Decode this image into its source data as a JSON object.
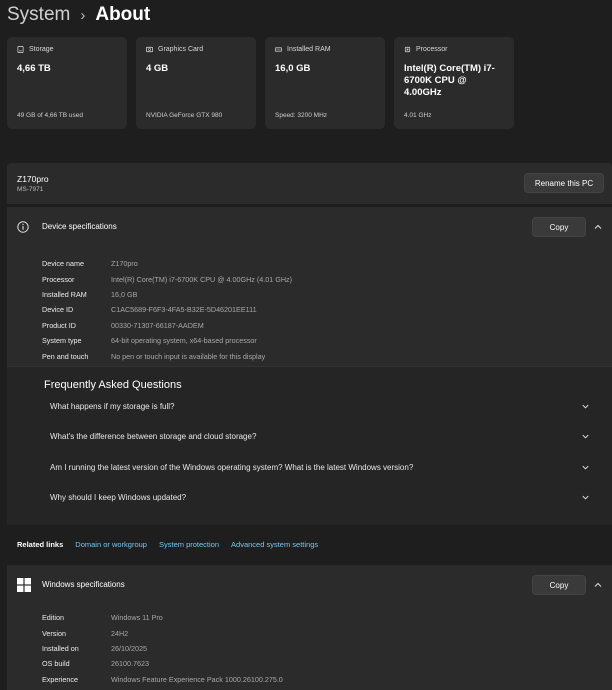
{
  "breadcrumb": {
    "parent": "System",
    "separator": "›",
    "current": "About"
  },
  "cards": [
    {
      "icon": "storage-icon",
      "label": "Storage",
      "value": "4,66 TB",
      "sub": "49 GB of 4,66 TB used"
    },
    {
      "icon": "graphics-card-icon",
      "label": "Graphics Card",
      "value": "4 GB",
      "sub": "NVIDIA GeForce GTX 980"
    },
    {
      "icon": "ram-icon",
      "label": "Installed RAM",
      "value": "16,0 GB",
      "sub": "Speed: 3200 MHz"
    },
    {
      "icon": "processor-icon",
      "label": "Processor",
      "value": "Intel(R) Core(TM) i7-6700K CPU @ 4.00GHz",
      "sub": "4.01 GHz"
    }
  ],
  "pc": {
    "name": "Z170pro",
    "model": "MS-7971",
    "rename_label": "Rename this PC"
  },
  "device_specs": {
    "title": "Device specifications",
    "copy_label": "Copy",
    "rows": [
      {
        "label": "Device name",
        "value": "Z170pro"
      },
      {
        "label": "Processor",
        "value": "Intel(R) Core(TM) i7-6700K CPU @ 4.00GHz (4.01 GHz)"
      },
      {
        "label": "Installed RAM",
        "value": "16,0 GB"
      },
      {
        "label": "Device ID",
        "value": "C1AC5689-F6F3-4FA5-B32E-5D46201EE111"
      },
      {
        "label": "Product ID",
        "value": "00330-71307-66187-AADEM"
      },
      {
        "label": "System type",
        "value": "64-bit operating system, x64-based processor"
      },
      {
        "label": "Pen and touch",
        "value": "No pen or touch input is available for this display"
      }
    ]
  },
  "faq": {
    "title": "Frequently Asked Questions",
    "items": [
      "What happens if my storage is full?",
      "What's the difference between storage and cloud storage?",
      "Am I running the latest version of the Windows operating system? What is the latest Windows version?",
      "Why should I keep Windows updated?"
    ]
  },
  "related": {
    "label": "Related links",
    "links": [
      "Domain or workgroup",
      "System protection",
      "Advanced system settings"
    ]
  },
  "windows_specs": {
    "title": "Windows specifications",
    "copy_label": "Copy",
    "rows": [
      {
        "label": "Edition",
        "value": "Windows 11 Pro"
      },
      {
        "label": "Version",
        "value": "24H2"
      },
      {
        "label": "Installed on",
        "value": "26/10/2025"
      },
      {
        "label": "OS build",
        "value": "26100.7623"
      },
      {
        "label": "Experience",
        "value": "Windows Feature Experience Pack 1000.26100.275.0"
      }
    ]
  },
  "colors": {
    "background": "#1e1e1e",
    "panel": "#2b2b2b",
    "link": "#78c6f0",
    "windows_logo": "#ffffff"
  }
}
